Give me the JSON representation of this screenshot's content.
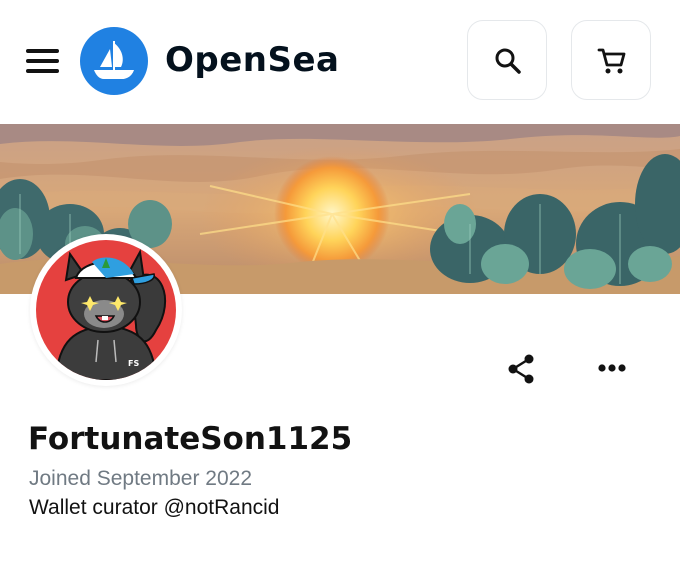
{
  "header": {
    "brand_name": "OpenSea",
    "menu_icon": "hamburger-menu-icon",
    "logo_icon": "sailboat-logo-icon",
    "search_icon": "search-icon",
    "cart_icon": "shopping-cart-icon",
    "brand_color": "#2081e2"
  },
  "banner": {
    "description_icon": "desert-sunset-banner-image"
  },
  "profile": {
    "avatar_icon": "cartoon-squirrel-avatar",
    "avatar_badge_text": "FS",
    "username": "FortunateSon1125",
    "joined": "Joined September 2022",
    "bio": "Wallet curator @notRancid",
    "avatar_bg_color": "#e5413f"
  },
  "actions": {
    "share_icon": "share-icon",
    "more_icon": "more-options-icon"
  }
}
